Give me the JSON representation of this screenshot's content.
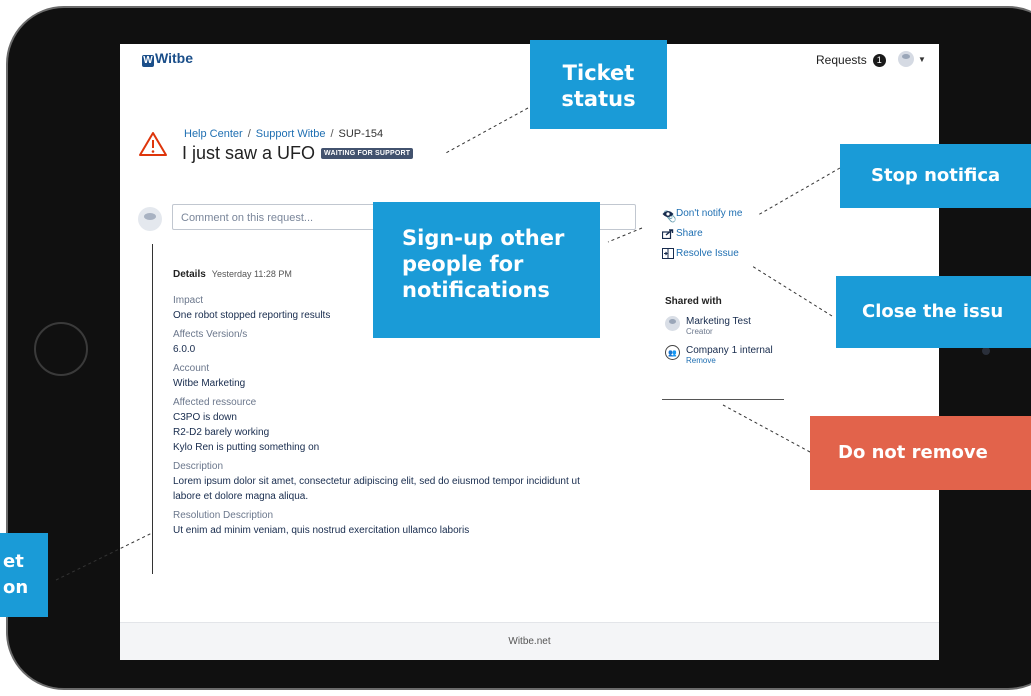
{
  "app": {
    "logo": "Witbe",
    "logo_initial": "W",
    "requests_label": "Requests",
    "requests_count": "1"
  },
  "breadcrumb": {
    "items": [
      "Help Center",
      "Support Witbe",
      "SUP-154"
    ]
  },
  "ticket": {
    "title": "I just saw a UFO",
    "status": "WAITING FOR SUPPORT"
  },
  "comment": {
    "placeholder": "Comment on this request..."
  },
  "details": {
    "heading": "Details",
    "time": "Yesterday 11:28 PM",
    "fields": [
      {
        "label": "Impact",
        "values": [
          "One robot stopped reporting results"
        ]
      },
      {
        "label": "Affects Version/s",
        "values": [
          "6.0.0"
        ]
      },
      {
        "label": "Account",
        "values": [
          "Witbe Marketing"
        ]
      },
      {
        "label": "Affected ressource",
        "values": [
          "C3PO is down",
          "R2-D2 barely working",
          "Kylo Ren is putting something on"
        ]
      },
      {
        "label": "Description",
        "values": [
          "Lorem ipsum dolor sit amet, consectetur adipiscing elit, sed do eiusmod tempor incididunt ut",
          "labore et dolore magna aliqua."
        ]
      },
      {
        "label": "Resolution Description",
        "values": [
          "Ut enim ad minim veniam, quis nostrud exercitation ullamco laboris"
        ]
      }
    ]
  },
  "actions": {
    "notify": "Don't notify me",
    "share": "Share",
    "resolve": "Resolve Issue"
  },
  "shared": {
    "heading": "Shared with",
    "person_name": "Marketing Test",
    "person_role": "Creator",
    "group_name": "Company 1 internal",
    "group_action": "Remove"
  },
  "footer": {
    "text": "Witbe.net"
  },
  "callouts": {
    "ticket_status": [
      "Ticket",
      "status"
    ],
    "signup": [
      "Sign-up other",
      "people for",
      "notifications"
    ],
    "stop": "Stop notifica",
    "close": "Close the issu",
    "remove": "Do not remove",
    "ticket_info": [
      "et",
      "on"
    ]
  },
  "colors": {
    "callout_blue": "#1a9bd7",
    "callout_red": "#e2634b",
    "link": "#1f6fb2",
    "lozenge": "#42526e"
  }
}
